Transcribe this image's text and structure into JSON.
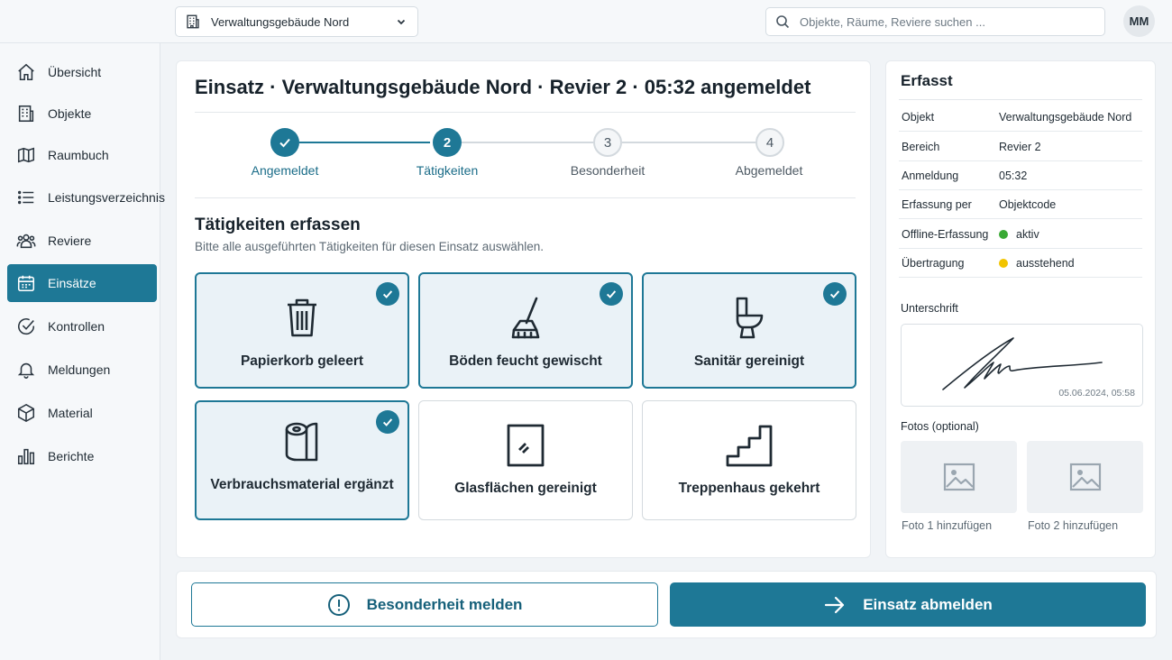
{
  "header": {
    "object_select": "Verwaltungsgebäude Nord",
    "search_placeholder": "Objekte, Räume, Reviere suchen ...",
    "avatar_initials": "MM"
  },
  "sidebar": {
    "items": [
      {
        "label": "Übersicht",
        "icon": "home-icon"
      },
      {
        "label": "Objekte",
        "icon": "building-icon"
      },
      {
        "label": "Raumbuch",
        "icon": "map-icon"
      },
      {
        "label": "Leistungsverzeichnis",
        "icon": "list-icon"
      },
      {
        "label": "Reviere",
        "icon": "team-icon"
      },
      {
        "label": "Einsätze",
        "icon": "calendar-icon",
        "active": true
      },
      {
        "label": "Kontrollen",
        "icon": "check-circle-icon"
      },
      {
        "label": "Meldungen",
        "icon": "bell-icon"
      },
      {
        "label": "Material",
        "icon": "box-icon"
      },
      {
        "label": "Berichte",
        "icon": "bar-chart-icon"
      }
    ]
  },
  "main": {
    "title": "Einsatz · Verwaltungsgebäude Nord · Revier 2 · 05:32 angemeldet",
    "steps": [
      {
        "number": "1",
        "label": "Angemeldet",
        "state": "done"
      },
      {
        "number": "2",
        "label": "Tätigkeiten",
        "state": "current"
      },
      {
        "number": "3",
        "label": "Besonderheit",
        "state": "todo"
      },
      {
        "number": "4",
        "label": "Abgemeldet",
        "state": "todo"
      }
    ],
    "section_title": "Tätigkeiten erfassen",
    "section_subtitle": "Bitte alle ausgeführten Tätigkeiten für diesen Einsatz auswählen.",
    "tasks": [
      {
        "label": "Papierkorb geleert",
        "icon": "trash-icon",
        "checked": true
      },
      {
        "label": "Böden feucht gewischt",
        "icon": "broom-icon",
        "checked": true
      },
      {
        "label": "Sanitär gereinigt",
        "icon": "toilet-icon",
        "checked": true
      },
      {
        "label": "Verbrauchsmaterial ergänzt",
        "icon": "toilet-paper-icon",
        "checked": true
      },
      {
        "label": "Glasflächen gereinigt",
        "icon": "window-icon",
        "checked": false
      },
      {
        "label": "Treppenhaus gekehrt",
        "icon": "stairs-icon",
        "checked": false
      }
    ]
  },
  "summary": {
    "title": "Erfasst",
    "rows": [
      {
        "key": "Objekt",
        "value": "Verwaltungsgebäude Nord"
      },
      {
        "key": "Bereich",
        "value": "Revier 2"
      },
      {
        "key": "Anmeldung",
        "value": "05:32"
      },
      {
        "key": "Erfassung per",
        "value": "Objektcode"
      },
      {
        "key": "Offline-Erfassung",
        "value": "aktiv",
        "status_color": "#3aa935"
      },
      {
        "key": "Übertragung",
        "value": "ausstehend",
        "status_color": "#f2c400"
      }
    ],
    "signature_label": "Unterschrift",
    "signature_timestamp": "05.06.2024, 05:58",
    "photos_label": "Fotos (optional)",
    "photos": [
      "Foto 1 hinzufügen",
      "Foto 2 hinzufügen"
    ]
  },
  "actions": {
    "report_label": "Besonderheit melden",
    "checkout_label": "Einsatz abmelden"
  },
  "colors": {
    "accent": "#1e7896",
    "status_active": "#3aa935",
    "status_pending": "#f2c400"
  }
}
